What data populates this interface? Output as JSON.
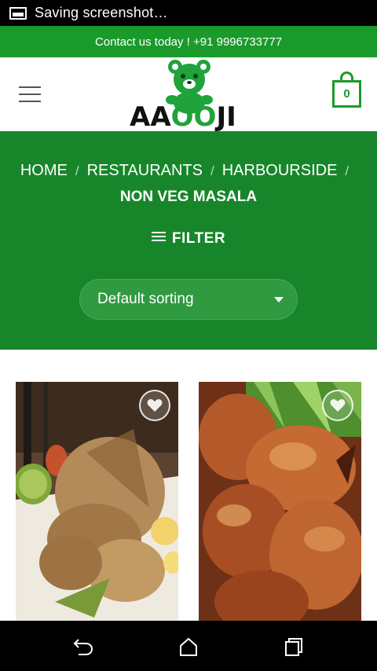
{
  "status_bar": {
    "notification": "Saving screenshot…",
    "notification_icon": "screenshot-icon"
  },
  "top_bar": {
    "contact_text": "Contact us today ! +91 9996733777"
  },
  "header": {
    "logo_text": "AAOOJI",
    "cart_count": "0"
  },
  "breadcrumb": [
    {
      "label": "HOME"
    },
    {
      "label": "RESTAURANTS"
    },
    {
      "label": "HARBOURSIDE"
    }
  ],
  "breadcrumb_separator": "/",
  "page_title": "NON VEG MASALA",
  "filter": {
    "label": "FILTER"
  },
  "sorting": {
    "selected": "Default sorting"
  },
  "products": [
    {
      "image": "grilled-chicken-with-mint-chutney",
      "wishlist_icon": "heart-icon"
    },
    {
      "image": "roast-chicken-pieces",
      "wishlist_icon": "heart-icon"
    }
  ],
  "colors": {
    "brand_green": "#1b9a2c",
    "hero_green": "#17862a"
  },
  "nav_bar": {
    "icons": [
      "back-icon",
      "home-icon",
      "recent-apps-icon"
    ]
  }
}
